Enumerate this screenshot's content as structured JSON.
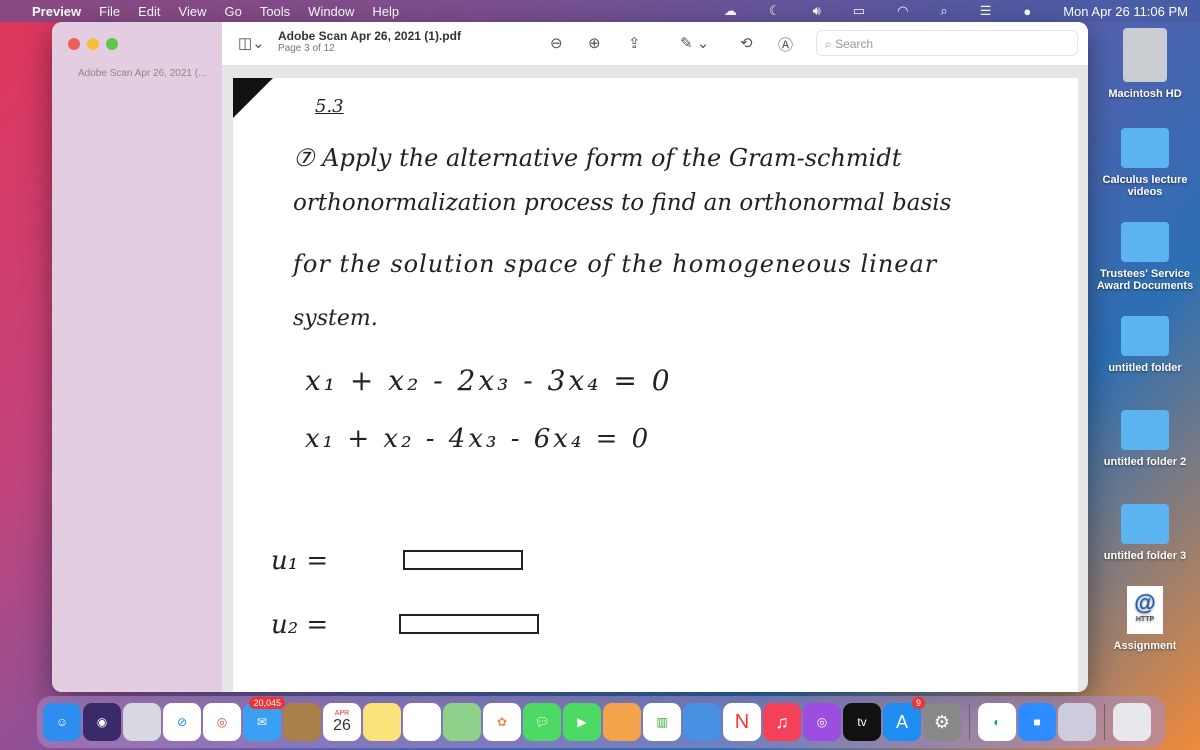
{
  "menubar": {
    "items": [
      "Preview",
      "File",
      "Edit",
      "View",
      "Go",
      "Tools",
      "Window",
      "Help"
    ],
    "clock": "Mon Apr 26  11:06 PM"
  },
  "window": {
    "sidebar_doc": "Adobe Scan Apr 26, 2021 (...",
    "title": "Adobe Scan Apr 26, 2021 (1).pdf",
    "subtitle": "Page 3 of 12",
    "search_placeholder": "Search"
  },
  "page": {
    "section": "5.3",
    "line1": "⑦ Apply the alternative form of the Gram-schmidt",
    "line2": "orthonormalization process to find an orthonormal basis",
    "line3": "for the solution space of the homogeneous linear",
    "line4": "system.",
    "eq1": "x₁ + x₂ - 2x₃ - 3x₄ = 0",
    "eq2": "x₁ + x₂ - 4x₃ - 6x₄ = 0",
    "u1": "u₁  =",
    "u2": "u₂  ="
  },
  "desktop": [
    {
      "label": "Macintosh HD"
    },
    {
      "label": "Calculus lecture videos"
    },
    {
      "label": "Trustees' Service Award Documents"
    },
    {
      "label": "untitled folder"
    },
    {
      "label": "untitled folder 2"
    },
    {
      "label": "untitled folder 3"
    },
    {
      "label": "Assignment",
      "icon_text": "HTTP"
    }
  ],
  "dock": {
    "mail_badge": "20,045",
    "calendar_month": "APR",
    "calendar_day": "26",
    "appstore_badge": "9",
    "tv_label": "tv"
  }
}
